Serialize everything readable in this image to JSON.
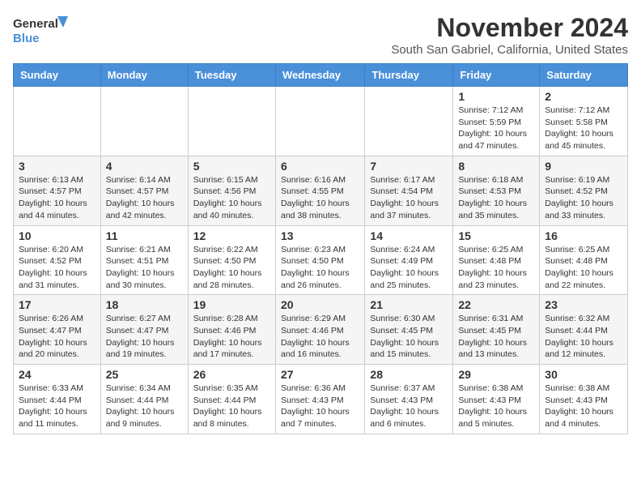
{
  "logo": {
    "text_general": "General",
    "text_blue": "Blue"
  },
  "header": {
    "month": "November 2024",
    "location": "South San Gabriel, California, United States"
  },
  "weekdays": [
    "Sunday",
    "Monday",
    "Tuesday",
    "Wednesday",
    "Thursday",
    "Friday",
    "Saturday"
  ],
  "weeks": [
    [
      {
        "day": "",
        "info": ""
      },
      {
        "day": "",
        "info": ""
      },
      {
        "day": "",
        "info": ""
      },
      {
        "day": "",
        "info": ""
      },
      {
        "day": "",
        "info": ""
      },
      {
        "day": "1",
        "info": "Sunrise: 7:12 AM\nSunset: 5:59 PM\nDaylight: 10 hours and 47 minutes."
      },
      {
        "day": "2",
        "info": "Sunrise: 7:12 AM\nSunset: 5:58 PM\nDaylight: 10 hours and 45 minutes."
      }
    ],
    [
      {
        "day": "3",
        "info": "Sunrise: 6:13 AM\nSunset: 4:57 PM\nDaylight: 10 hours and 44 minutes."
      },
      {
        "day": "4",
        "info": "Sunrise: 6:14 AM\nSunset: 4:57 PM\nDaylight: 10 hours and 42 minutes."
      },
      {
        "day": "5",
        "info": "Sunrise: 6:15 AM\nSunset: 4:56 PM\nDaylight: 10 hours and 40 minutes."
      },
      {
        "day": "6",
        "info": "Sunrise: 6:16 AM\nSunset: 4:55 PM\nDaylight: 10 hours and 38 minutes."
      },
      {
        "day": "7",
        "info": "Sunrise: 6:17 AM\nSunset: 4:54 PM\nDaylight: 10 hours and 37 minutes."
      },
      {
        "day": "8",
        "info": "Sunrise: 6:18 AM\nSunset: 4:53 PM\nDaylight: 10 hours and 35 minutes."
      },
      {
        "day": "9",
        "info": "Sunrise: 6:19 AM\nSunset: 4:52 PM\nDaylight: 10 hours and 33 minutes."
      }
    ],
    [
      {
        "day": "10",
        "info": "Sunrise: 6:20 AM\nSunset: 4:52 PM\nDaylight: 10 hours and 31 minutes."
      },
      {
        "day": "11",
        "info": "Sunrise: 6:21 AM\nSunset: 4:51 PM\nDaylight: 10 hours and 30 minutes."
      },
      {
        "day": "12",
        "info": "Sunrise: 6:22 AM\nSunset: 4:50 PM\nDaylight: 10 hours and 28 minutes."
      },
      {
        "day": "13",
        "info": "Sunrise: 6:23 AM\nSunset: 4:50 PM\nDaylight: 10 hours and 26 minutes."
      },
      {
        "day": "14",
        "info": "Sunrise: 6:24 AM\nSunset: 4:49 PM\nDaylight: 10 hours and 25 minutes."
      },
      {
        "day": "15",
        "info": "Sunrise: 6:25 AM\nSunset: 4:48 PM\nDaylight: 10 hours and 23 minutes."
      },
      {
        "day": "16",
        "info": "Sunrise: 6:25 AM\nSunset: 4:48 PM\nDaylight: 10 hours and 22 minutes."
      }
    ],
    [
      {
        "day": "17",
        "info": "Sunrise: 6:26 AM\nSunset: 4:47 PM\nDaylight: 10 hours and 20 minutes."
      },
      {
        "day": "18",
        "info": "Sunrise: 6:27 AM\nSunset: 4:47 PM\nDaylight: 10 hours and 19 minutes."
      },
      {
        "day": "19",
        "info": "Sunrise: 6:28 AM\nSunset: 4:46 PM\nDaylight: 10 hours and 17 minutes."
      },
      {
        "day": "20",
        "info": "Sunrise: 6:29 AM\nSunset: 4:46 PM\nDaylight: 10 hours and 16 minutes."
      },
      {
        "day": "21",
        "info": "Sunrise: 6:30 AM\nSunset: 4:45 PM\nDaylight: 10 hours and 15 minutes."
      },
      {
        "day": "22",
        "info": "Sunrise: 6:31 AM\nSunset: 4:45 PM\nDaylight: 10 hours and 13 minutes."
      },
      {
        "day": "23",
        "info": "Sunrise: 6:32 AM\nSunset: 4:44 PM\nDaylight: 10 hours and 12 minutes."
      }
    ],
    [
      {
        "day": "24",
        "info": "Sunrise: 6:33 AM\nSunset: 4:44 PM\nDaylight: 10 hours and 11 minutes."
      },
      {
        "day": "25",
        "info": "Sunrise: 6:34 AM\nSunset: 4:44 PM\nDaylight: 10 hours and 9 minutes."
      },
      {
        "day": "26",
        "info": "Sunrise: 6:35 AM\nSunset: 4:44 PM\nDaylight: 10 hours and 8 minutes."
      },
      {
        "day": "27",
        "info": "Sunrise: 6:36 AM\nSunset: 4:43 PM\nDaylight: 10 hours and 7 minutes."
      },
      {
        "day": "28",
        "info": "Sunrise: 6:37 AM\nSunset: 4:43 PM\nDaylight: 10 hours and 6 minutes."
      },
      {
        "day": "29",
        "info": "Sunrise: 6:38 AM\nSunset: 4:43 PM\nDaylight: 10 hours and 5 minutes."
      },
      {
        "day": "30",
        "info": "Sunrise: 6:38 AM\nSunset: 4:43 PM\nDaylight: 10 hours and 4 minutes."
      }
    ]
  ]
}
